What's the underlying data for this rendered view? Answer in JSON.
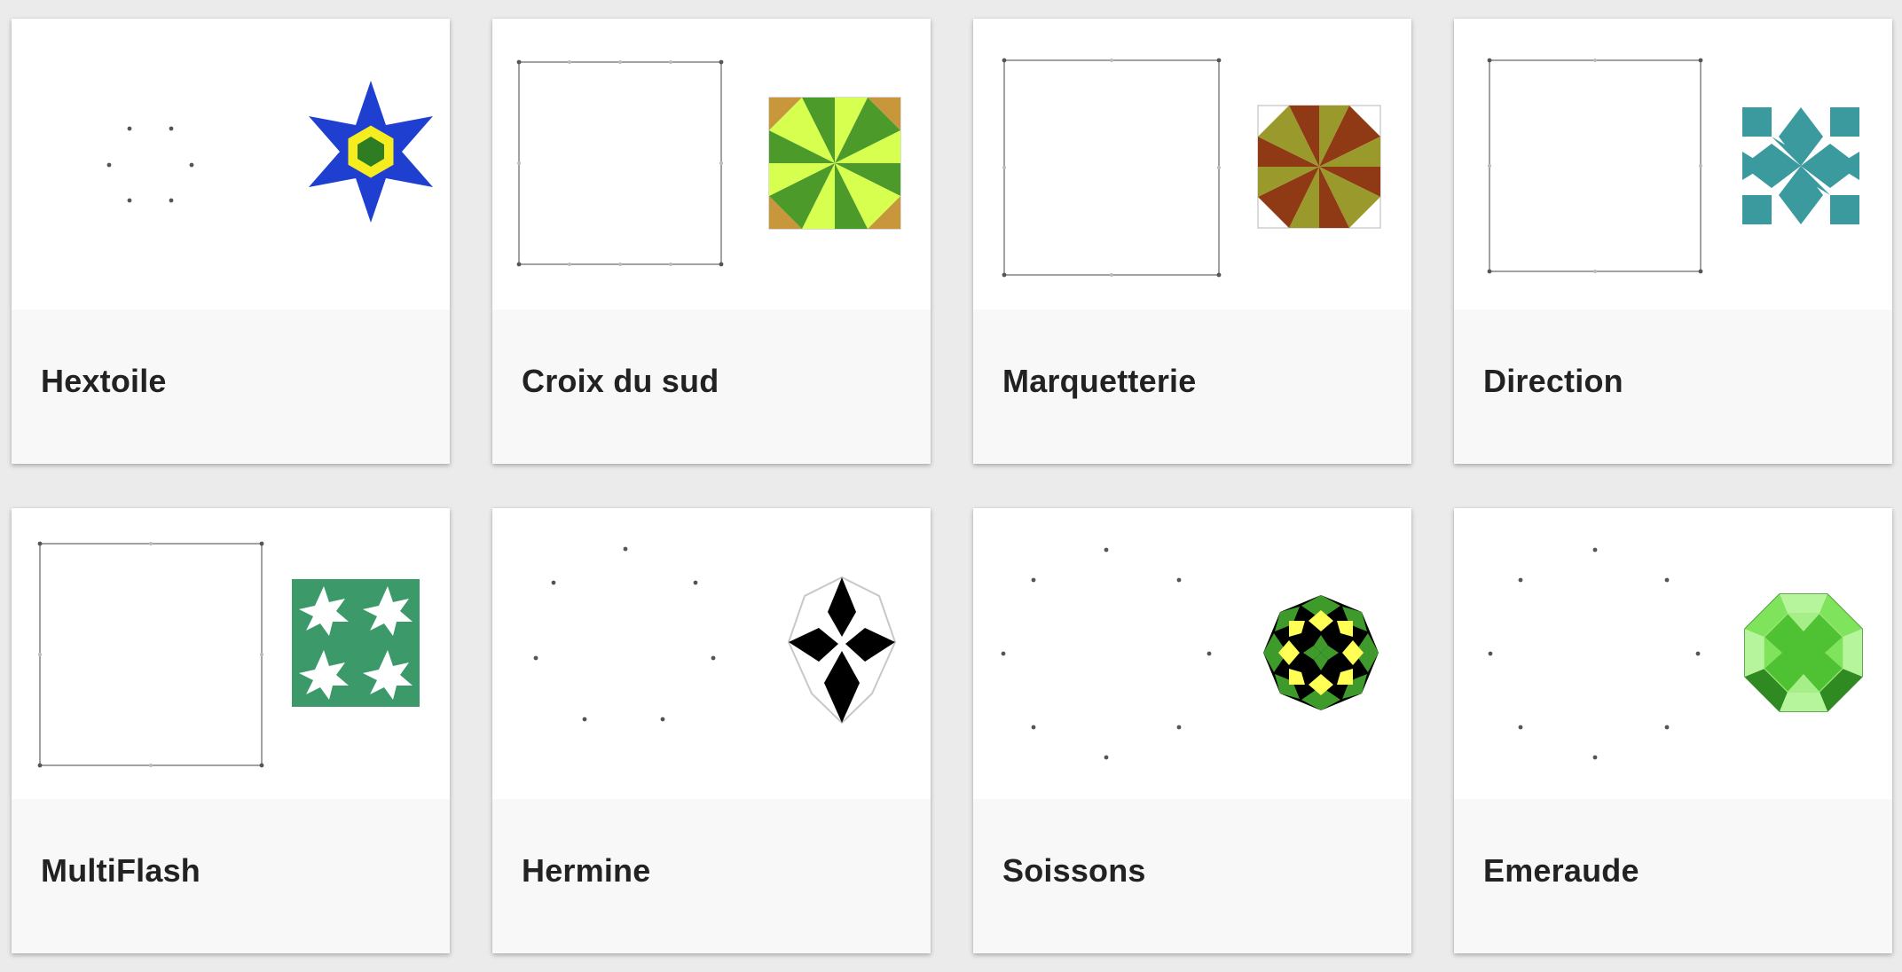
{
  "cards": [
    {
      "title": "Hextoile",
      "accent": "#1f3fd1"
    },
    {
      "title": "Croix du sud",
      "accent": "#4c9a2a"
    },
    {
      "title": "Marquetterie",
      "accent": "#8f3a14"
    },
    {
      "title": "Direction",
      "accent": "#3a9a9e"
    },
    {
      "title": "MultiFlash",
      "accent": "#3c9a6a"
    },
    {
      "title": "Hermine",
      "accent": "#000000"
    },
    {
      "title": "Soissons",
      "accent": "#3f9a2c"
    },
    {
      "title": "Emeraude",
      "accent": "#4fc234"
    }
  ]
}
